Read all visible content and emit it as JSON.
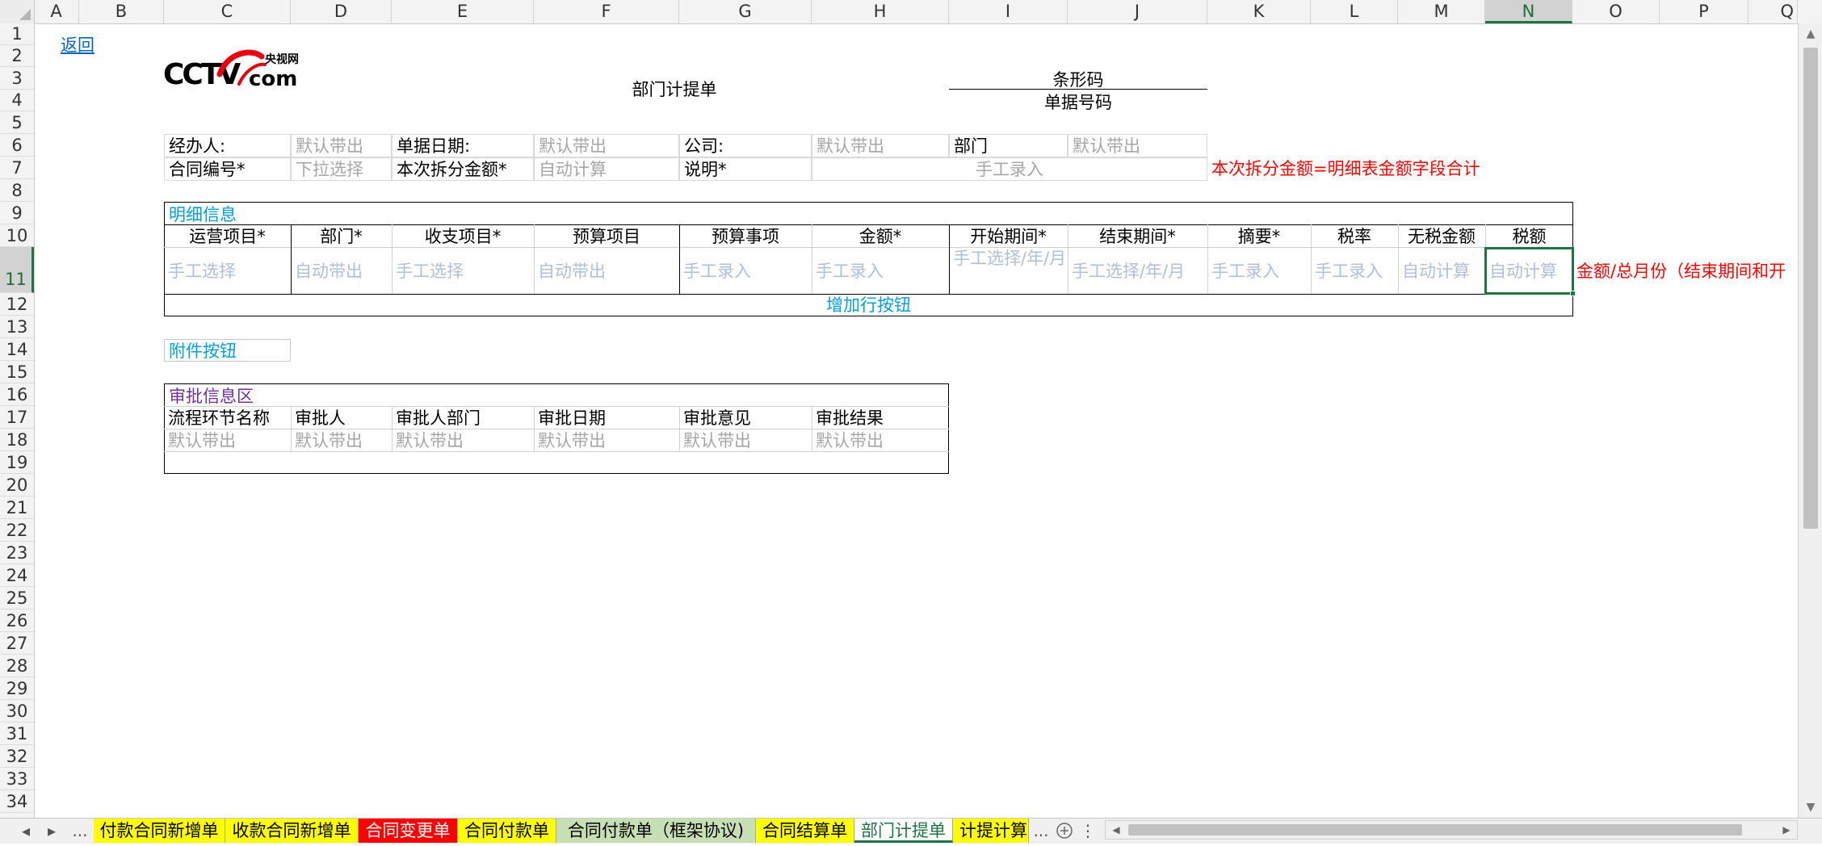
{
  "columns": [
    "A",
    "B",
    "C",
    "D",
    "E",
    "F",
    "G",
    "H",
    "I",
    "J",
    "K",
    "L",
    "M",
    "N",
    "O",
    "P",
    "Q"
  ],
  "active_column": "N",
  "active_row": 11,
  "rows": [
    "1",
    "2",
    "3",
    "4",
    "5",
    "6",
    "7",
    "8",
    "9",
    "10",
    "11",
    "12",
    "13",
    "14",
    "15",
    "16",
    "17",
    "18",
    "19",
    "20",
    "21",
    "22",
    "23",
    "24",
    "25",
    "26",
    "27",
    "28",
    "29",
    "30",
    "31",
    "32",
    "33",
    "34"
  ],
  "back_link": "返回",
  "form_title": "部门计提单",
  "barcode_label": "条形码",
  "doc_number_label": "单据号码",
  "header_fields": {
    "handler_label": "经办人:",
    "handler_value": "默认带出",
    "doc_date_label": "单据日期:",
    "doc_date_value": "默认带出",
    "company_label": "公司:",
    "company_value": "默认带出",
    "dept_label": "部门",
    "dept_value": "默认带出",
    "contract_no_label": "合同编号*",
    "contract_no_value": "下拉选择",
    "split_amount_label": "本次拆分金额*",
    "split_amount_value": "自动计算",
    "desc_label": "说明*",
    "desc_value": "手工录入"
  },
  "note_split_amount": "本次拆分金额=明细表金额字段合计",
  "detail_section_title": "明细信息",
  "detail_headers": [
    "运营项目*",
    "部门*",
    "收支项目*",
    "预算项目",
    "预算事项",
    "金额*",
    "开始期间*",
    "结束期间*",
    "摘要*",
    "税率",
    "无税金额",
    "税额"
  ],
  "detail_row": [
    "手工选择",
    "自动带出",
    "手工选择",
    "自动带出",
    "手工录入",
    "手工录入",
    "手工选择/年/月",
    "手工选择/年/月",
    "手工录入",
    "手工录入",
    "自动计算",
    "自动计算"
  ],
  "note_tax": "金额/总月份（结束期间和开",
  "add_row_button": "增加行按钮",
  "attachment_button": "附件按钮",
  "approval_section_title": "审批信息区",
  "approval_headers": [
    "流程环节名称",
    "审批人",
    "审批人部门",
    "审批日期",
    "审批意见",
    "审批结果"
  ],
  "approval_row": [
    "默认带出",
    "默认带出",
    "默认带出",
    "默认带出",
    "默认带出",
    "默认带出"
  ],
  "sheet_tabs": [
    {
      "label": "付款合同新增单",
      "color": "#ffff00"
    },
    {
      "label": "收款合同新增单",
      "color": "#ffff00"
    },
    {
      "label": "合同变更单",
      "color": "#ff0000"
    },
    {
      "label": "合同付款单",
      "color": "#ffff00"
    },
    {
      "label": "合同付款单（框架协议)",
      "color": "#c6e0b4"
    },
    {
      "label": "合同结算单",
      "color": "#ffff00"
    },
    {
      "label": "部门计提单",
      "color": "#ffffff"
    },
    {
      "label": "计提计算",
      "color": "#ffff00"
    }
  ],
  "tab_overflow": "...",
  "colors": {
    "accent_green": "#217346",
    "note_red": "#ff0000",
    "section_teal": "#00a0d6",
    "approval_purple": "#7030a0"
  },
  "icons": [
    "tab-scroll-left-icon",
    "tab-scroll-right-icon",
    "add-sheet-icon",
    "options-dots-icon",
    "scroll-left-icon",
    "scroll-right-icon",
    "scroll-up-icon",
    "scroll-down-icon",
    "cctv-logo"
  ]
}
